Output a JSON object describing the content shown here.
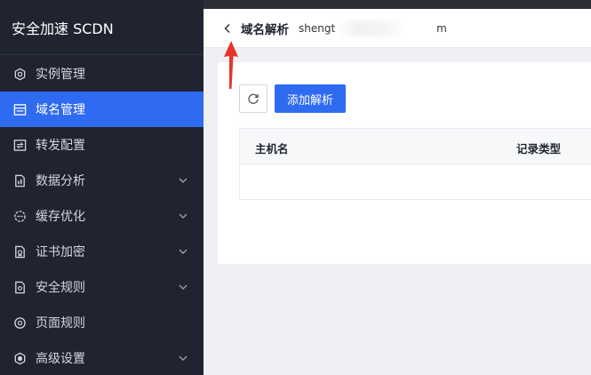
{
  "sidebar": {
    "brand": "安全加速 SCDN",
    "items": [
      {
        "label": "实例管理",
        "icon": "hexagon-icon",
        "expandable": false,
        "active": false
      },
      {
        "label": "域名管理",
        "icon": "list-icon",
        "expandable": false,
        "active": true
      },
      {
        "label": "转发配置",
        "icon": "forward-icon",
        "expandable": false,
        "active": false
      },
      {
        "label": "数据分析",
        "icon": "chart-icon",
        "expandable": true,
        "active": false
      },
      {
        "label": "缓存优化",
        "icon": "cache-icon",
        "expandable": true,
        "active": false
      },
      {
        "label": "证书加密",
        "icon": "certificate-icon",
        "expandable": true,
        "active": false
      },
      {
        "label": "安全规则",
        "icon": "document-icon",
        "expandable": true,
        "active": false
      },
      {
        "label": "页面规则",
        "icon": "page-rule-icon",
        "expandable": false,
        "active": false
      },
      {
        "label": "高级设置",
        "icon": "shield-icon",
        "expandable": true,
        "active": false
      }
    ]
  },
  "header": {
    "title": "域名解析",
    "domain_prefix": "shengt",
    "domain_suffix": "m"
  },
  "toolbar": {
    "add_label": "添加解析"
  },
  "table": {
    "columns": [
      "主机名",
      "记录类型"
    ]
  },
  "colors": {
    "sidebar_bg": "#1f2430",
    "active": "#2f6bf0",
    "annotation": "#e8332b"
  }
}
